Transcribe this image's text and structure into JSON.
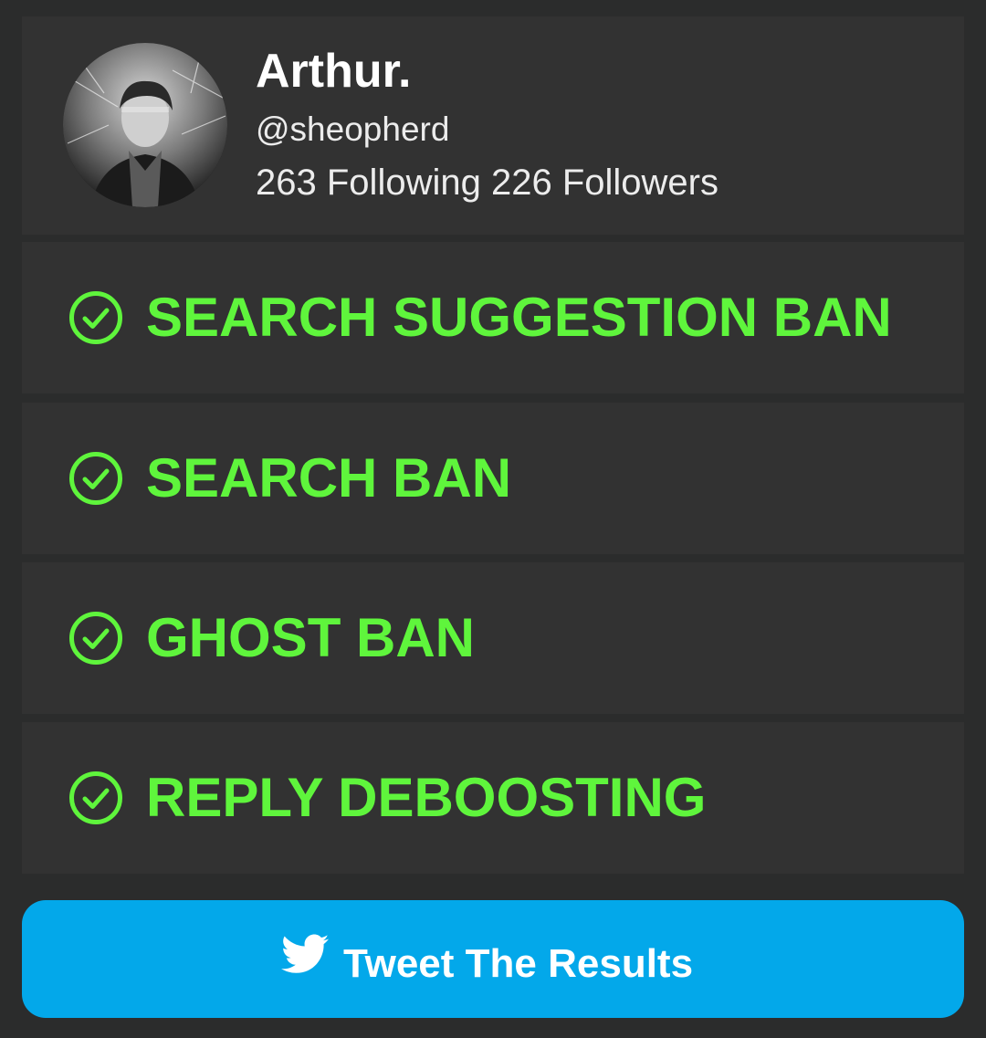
{
  "profile": {
    "display_name": "Arthur.",
    "handle": "@sheopherd",
    "following_count": "263",
    "following_label": "Following",
    "followers_count": "226",
    "followers_label": "Followers"
  },
  "checks": [
    {
      "label": "SEARCH SUGGESTION BAN",
      "icon": "check-circle-icon",
      "status": "passed"
    },
    {
      "label": "SEARCH BAN",
      "icon": "check-circle-icon",
      "status": "passed"
    },
    {
      "label": "GHOST BAN",
      "icon": "check-circle-icon",
      "status": "passed"
    },
    {
      "label": "REPLY DEBOOSTING",
      "icon": "check-circle-icon",
      "status": "passed"
    }
  ],
  "tweet_button": {
    "label": "Tweet The Results",
    "icon": "twitter-bird-icon"
  },
  "colors": {
    "background": "#2b2c2c",
    "card": "#323232",
    "pass_green": "#5ff53c",
    "twitter_blue": "#03a8ea",
    "text_white": "#ffffff"
  }
}
